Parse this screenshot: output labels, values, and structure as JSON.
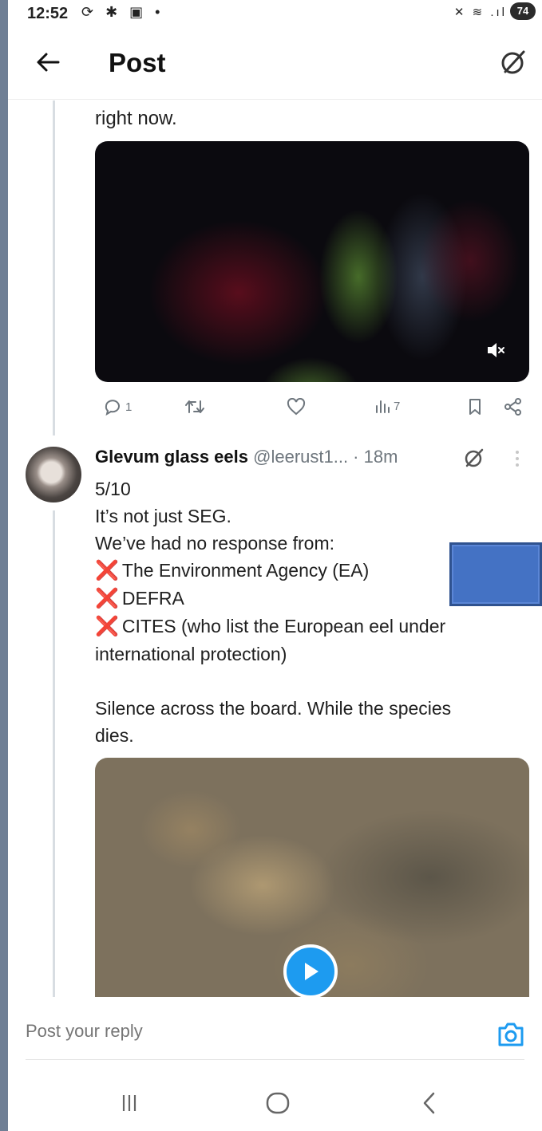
{
  "status_bar": {
    "time": "12:52",
    "left_icons": "⟳ ✱ ▣ •",
    "right_icons": "✕ ≋ .ıl",
    "battery": "74"
  },
  "header": {
    "title": "Post",
    "back_icon": "arrow-left-icon",
    "grok_icon": "grok-slash-circle-icon"
  },
  "post1": {
    "text_tail": "right now.",
    "media": {
      "type": "video",
      "sound_icon": "speaker-muted-icon"
    },
    "actions": {
      "replies": "1",
      "reposts": "",
      "likes": "",
      "views": "7"
    }
  },
  "post2": {
    "author_name": "Glevum glass eels",
    "author_handle": "@leerust1...",
    "separator": " · ",
    "time": "18m",
    "body": {
      "line1": "5/10",
      "line2": "It’s not just SEG.",
      "line3": "We’ve had no response from:",
      "cross": "❌",
      "item1": "The Environment Agency (EA)",
      "item2": "DEFRA",
      "item3_a": "CITES (who list the European eel under",
      "item3_b": "international protection)",
      "line4": "Silence across the board. While the species",
      "line5": "dies."
    },
    "media": {
      "type": "video",
      "play_icon": "play-icon"
    }
  },
  "reply_bar": {
    "placeholder": "Post your reply",
    "camera_icon": "camera-icon"
  },
  "nav_bar": {
    "recents_icon": "recents-icon",
    "home_icon": "home-icon",
    "back_icon": "back-chevron-icon"
  },
  "colors": {
    "accent_blue": "#1d9bf0",
    "cross_red": "#e0245e",
    "overlay_rect": "#4472c4",
    "text_muted": "#6e767d"
  }
}
